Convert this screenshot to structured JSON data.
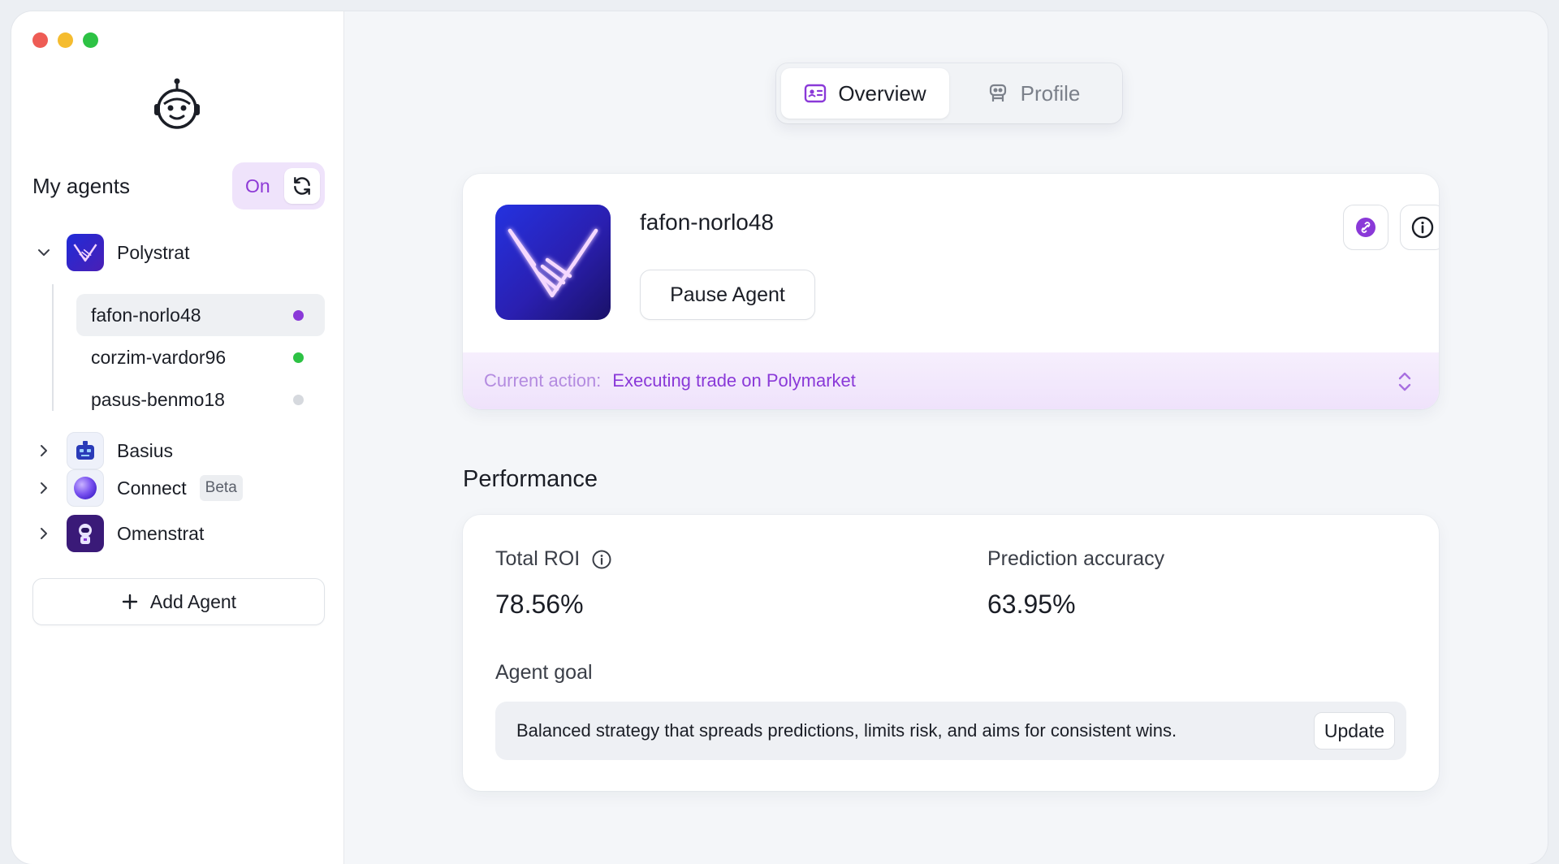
{
  "colors": {
    "accent": "#8a39d8",
    "traffic_red": "#ee5c55",
    "traffic_yellow": "#f5bc2f",
    "traffic_green": "#2dc244",
    "status_active": "#8a39d8",
    "status_running": "#2dc244",
    "status_idle": "#d6d9de"
  },
  "sidebar": {
    "title": "My agents",
    "toggle_label": "On",
    "groups": [
      {
        "label": "Polystrat",
        "expanded": true,
        "icon": "polystrat-logo",
        "agents": [
          {
            "name": "fafon-norlo48",
            "active": true,
            "status": "active"
          },
          {
            "name": "corzim-vardor96",
            "active": false,
            "status": "running"
          },
          {
            "name": "pasus-benmo18",
            "active": false,
            "status": "idle"
          }
        ]
      },
      {
        "label": "Basius",
        "expanded": false,
        "icon": "basius-robot"
      },
      {
        "label": "Connect",
        "expanded": false,
        "icon": "connect-orb",
        "badge": "Beta"
      },
      {
        "label": "Omenstrat",
        "expanded": false,
        "icon": "omenstrat-astronaut"
      }
    ],
    "add_agent_label": "Add Agent"
  },
  "tabs": [
    {
      "label": "Overview",
      "active": true,
      "icon": "id-card-icon"
    },
    {
      "label": "Profile",
      "active": false,
      "icon": "robot-icon"
    }
  ],
  "agent_card": {
    "name": "fafon-norlo48",
    "pause_label": "Pause Agent",
    "current_action_label": "Current action:",
    "current_action_value": "Executing trade on Polymarket"
  },
  "performance": {
    "title": "Performance",
    "roi_label": "Total ROI",
    "roi_value": "78.56%",
    "accuracy_label": "Prediction accuracy",
    "accuracy_value": "63.95%",
    "goal_label": "Agent goal",
    "goal_text": "Balanced strategy that spreads predictions, limits risk, and aims for consistent wins.",
    "update_label": "Update"
  }
}
